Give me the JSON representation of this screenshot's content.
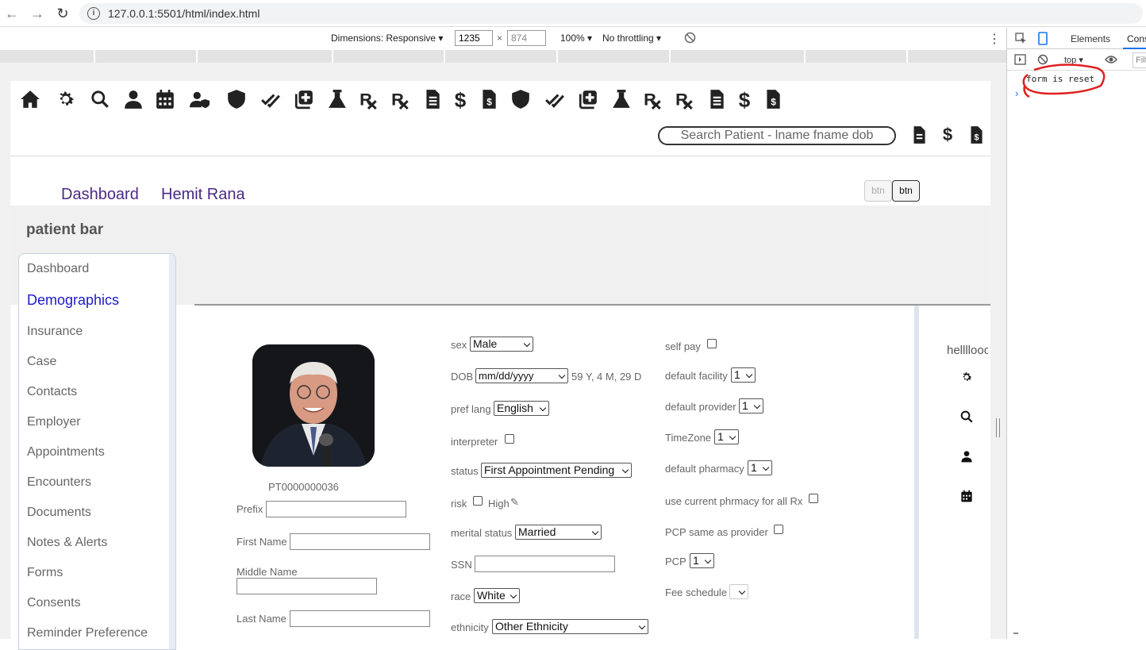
{
  "browser": {
    "url": "127.0.0.1:5501/html/index.html"
  },
  "devtools_toolbar": {
    "dimensions_label": "Dimensions: Responsive",
    "width_value": "1235",
    "times": "×",
    "height_value": "874",
    "zoom": "100%",
    "throttling": "No throttling"
  },
  "devtools_panel": {
    "tab_elements": "Elements",
    "tab_console": "Cons",
    "context": "top",
    "filter_placeholder": "Filt",
    "console_message": "form is reset",
    "prompt": "›"
  },
  "header": {
    "search_placeholder": "Search Patient - lname fname dob",
    "nav_dashboard": "Dashboard",
    "nav_user": "Hemit Rana",
    "btn1": "btn",
    "btn2": "btn"
  },
  "patient_bar": {
    "title": "patient bar"
  },
  "sidebar": {
    "items": [
      "Dashboard",
      "Demographics",
      "Insurance",
      "Case",
      "Contacts",
      "Employer",
      "Appointments",
      "Encounters",
      "Documents",
      "Notes & Alerts",
      "Forms",
      "Consents",
      "Reminder Preference"
    ],
    "active_index": 1
  },
  "form": {
    "patient_id": "PT0000000036",
    "prefix_label": "Prefix",
    "first_name_label": "First Name",
    "middle_name_label": "Middle Name",
    "last_name_label": "Last Name",
    "sex_label": "sex",
    "sex_value": "Male",
    "dob_label": "DOB",
    "dob_placeholder": "mm/dd/yyyy",
    "age": "59 Y, 4 M, 29 D",
    "pref_lang_label": "pref lang",
    "pref_lang_value": "English",
    "interpreter_label": "interpreter",
    "status_label": "status",
    "status_value": "First Appointment Pending",
    "risk_label": "risk",
    "risk_high": "High",
    "marital_label": "merital status",
    "marital_value": "Married",
    "ssn_label": "SSN",
    "race_label": "race",
    "race_value": "White",
    "ethnicity_label": "ethnicity",
    "ethnicity_value": "Other Ethnicity",
    "self_pay_label": "self pay",
    "default_facility_label": "default facility",
    "default_facility_value": "1",
    "default_provider_label": "default provider",
    "default_provider_value": "1",
    "timezone_label": "TimeZone",
    "timezone_value": "1",
    "default_pharmacy_label": "default pharmacy",
    "default_pharmacy_value": "1",
    "current_pharmacy_label": "use current phrmacy for all Rx",
    "pcp_same_label": "PCP same as provider",
    "pcp_label": "PCP",
    "pcp_value": "1",
    "fee_schedule_label": "Fee schedule"
  },
  "right_panel": {
    "title": "hellllooo"
  },
  "annotation_color": "#e02020",
  "link_color": "#4b2a86",
  "active_color": "#1a1acc"
}
